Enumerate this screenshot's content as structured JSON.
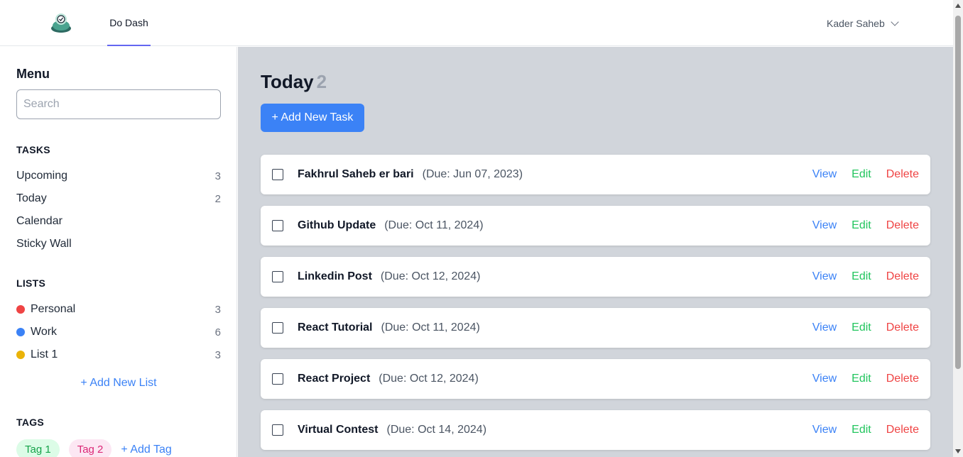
{
  "app": {
    "nav_tab": "Do Dash",
    "user_name": "Kader Saheb"
  },
  "sidebar": {
    "title": "Menu",
    "search_placeholder": "Search",
    "tasks_heading": "TASKS",
    "tasks": [
      {
        "label": "Upcoming",
        "count": "3"
      },
      {
        "label": "Today",
        "count": "2"
      },
      {
        "label": "Calendar",
        "count": ""
      },
      {
        "label": "Sticky Wall",
        "count": ""
      }
    ],
    "lists_heading": "LISTS",
    "lists": [
      {
        "label": "Personal",
        "count": "3",
        "color": "#ef4444"
      },
      {
        "label": "Work",
        "count": "6",
        "color": "#3b82f6"
      },
      {
        "label": "List 1",
        "count": "3",
        "color": "#eab308"
      }
    ],
    "add_list": "+ Add New List",
    "tags_heading": "TAGS",
    "tags": [
      {
        "label": "Tag 1"
      },
      {
        "label": "Tag 2"
      }
    ],
    "add_tag": "+ Add Tag"
  },
  "main": {
    "title": "Today",
    "title_count": "2",
    "add_task": "+ Add New Task",
    "actions": {
      "view": "View",
      "edit": "Edit",
      "delete": "Delete"
    },
    "tasks": [
      {
        "name": "Fakhrul Saheb er bari",
        "due": "(Due: Jun 07, 2023)"
      },
      {
        "name": "Github Update",
        "due": "(Due: Oct 11, 2024)"
      },
      {
        "name": "Linkedin Post",
        "due": "(Due: Oct 12, 2024)"
      },
      {
        "name": "React Tutorial",
        "due": "(Due: Oct 11, 2024)"
      },
      {
        "name": "React Project",
        "due": "(Due: Oct 12, 2024)"
      },
      {
        "name": "Virtual Contest",
        "due": "(Due: Oct 14, 2024)"
      }
    ]
  },
  "colors": {
    "accent": "#3b82f6",
    "edit": "#22c55e",
    "delete": "#ef4444",
    "main_bg": "#d1d5db"
  }
}
